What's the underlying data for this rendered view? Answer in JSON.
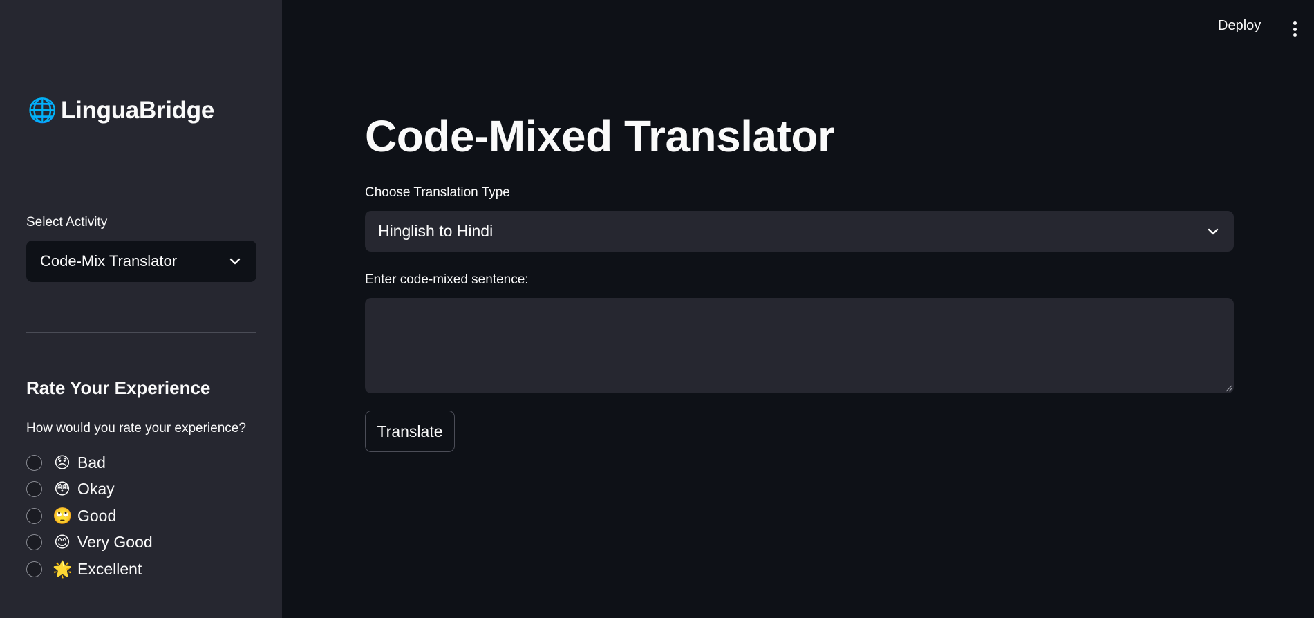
{
  "sidebar": {
    "brand_icon": "🌐",
    "brand_name": "LinguaBridge",
    "activity_label": "Select Activity",
    "activity_value": "Code-Mix Translator",
    "rating_heading": "Rate Your Experience",
    "rating_question": "How would you rate your experience?",
    "rating_options": [
      {
        "emoji": "😞",
        "label": "Bad"
      },
      {
        "emoji": "😳",
        "label": "Okay"
      },
      {
        "emoji": "🙄",
        "label": "Good"
      },
      {
        "emoji": "😊",
        "label": "Very Good"
      },
      {
        "emoji": "🌟",
        "label": "Excellent"
      }
    ]
  },
  "topbar": {
    "deploy_label": "Deploy",
    "menu_icon": "kebab-menu-icon"
  },
  "main": {
    "title": "Code-Mixed Translator",
    "translation_type_label": "Choose Translation Type",
    "translation_type_value": "Hinglish to Hindi",
    "sentence_label": "Enter code-mixed sentence:",
    "sentence_value": "",
    "sentence_placeholder": "",
    "translate_button": "Translate"
  },
  "colors": {
    "background": "#0e1117",
    "sidebar": "#262730",
    "input_bg": "#262730",
    "text": "#fafafa"
  }
}
